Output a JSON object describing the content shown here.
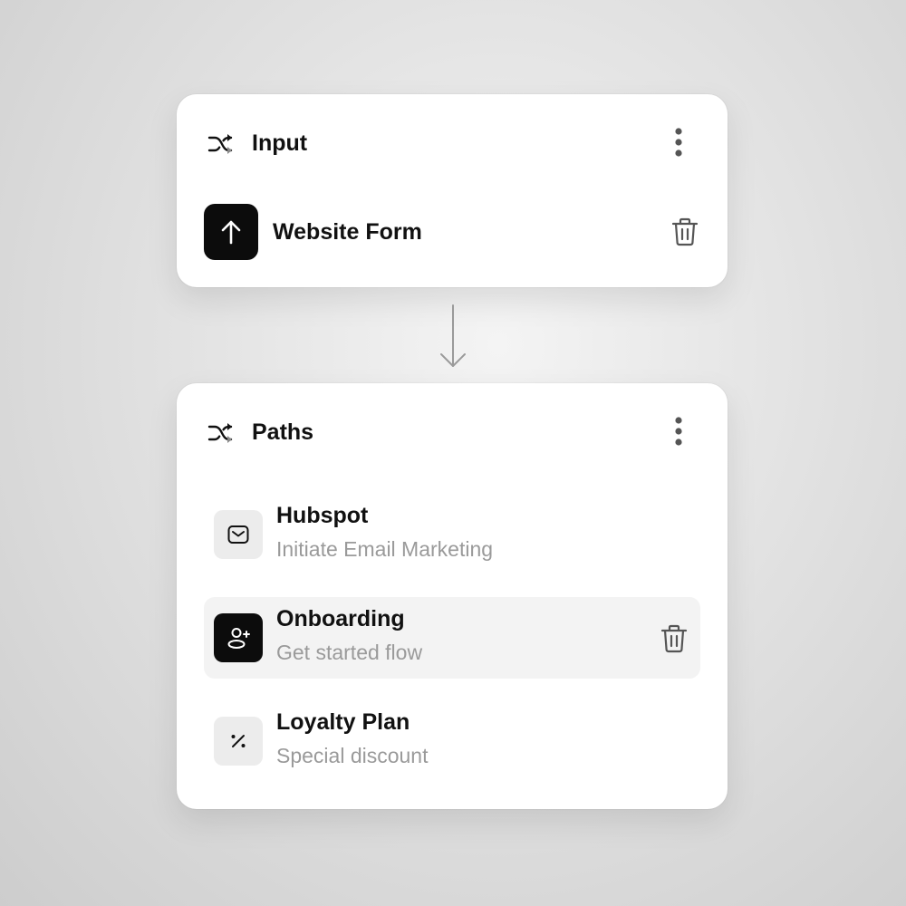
{
  "input_card": {
    "title": "Input",
    "source": {
      "label": "Website Form",
      "icon": "arrow-up-icon"
    }
  },
  "paths_card": {
    "title": "Paths",
    "items": [
      {
        "title": "Hubspot",
        "subtitle": "Initiate Email Marketing",
        "icon": "mail-icon",
        "selected": false
      },
      {
        "title": "Onboarding",
        "subtitle": "Get started flow",
        "icon": "user-add-icon",
        "selected": true
      },
      {
        "title": "Loyalty Plan",
        "subtitle": "Special discount",
        "icon": "percent-icon",
        "selected": false
      }
    ]
  },
  "colors": {
    "card_bg": "#ffffff",
    "dark_badge": "#0c0c0c",
    "light_badge": "#ececec",
    "selected_row": "#f3f3f3",
    "subtitle_text": "#9a9a9a"
  }
}
